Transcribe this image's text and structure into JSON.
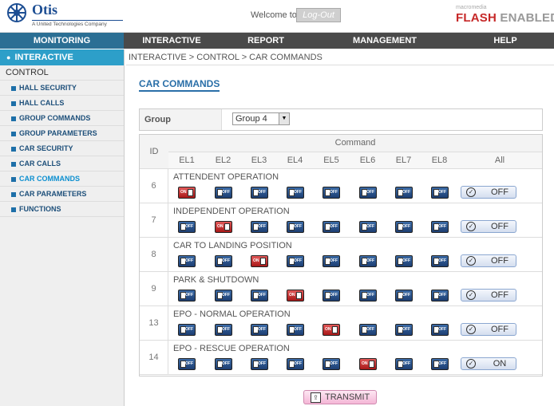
{
  "header": {
    "logo_name": "Otis",
    "logo_sub": "A United Technologies Company",
    "welcome": "Welcome to Otis",
    "logout": "Log-Out",
    "flash_brand": "macromedia",
    "flash_main": "FLASH",
    "flash_enabled": "ENABLED"
  },
  "nav": [
    "MONITORING",
    "INTERACTIVE",
    "REPORT",
    "MANAGEMENT",
    "HELP"
  ],
  "sidebar": {
    "head": "INTERACTIVE",
    "sub": "CONTROL",
    "items": [
      "HALL SECURITY",
      "HALL CALLS",
      "GROUP COMMANDS",
      "GROUP PARAMETERS",
      "CAR SECURITY",
      "CAR CALLS",
      "CAR COMMANDS",
      "CAR PARAMETERS",
      "FUNCTIONS"
    ],
    "active_index": 6
  },
  "breadcrumb": "INTERACTIVE > CONTROL > CAR COMMANDS",
  "page_title": "CAR COMMANDS",
  "group": {
    "label": "Group",
    "selected": "Group 4"
  },
  "table": {
    "id_header": "ID",
    "command_header": "Command",
    "columns": [
      "EL1",
      "EL2",
      "EL3",
      "EL4",
      "EL5",
      "EL6",
      "EL7",
      "EL8",
      "All"
    ],
    "switch_on_text": "ON",
    "switch_off_text": "OFF",
    "rows": [
      {
        "id": "6",
        "name": "ATTENDENT OPERATION",
        "states": [
          "on",
          "off",
          "off",
          "off",
          "off",
          "off",
          "off",
          "off"
        ],
        "all": "OFF"
      },
      {
        "id": "7",
        "name": "INDEPENDENT OPERATION",
        "states": [
          "off",
          "on",
          "off",
          "off",
          "off",
          "off",
          "off",
          "off"
        ],
        "all": "OFF"
      },
      {
        "id": "8",
        "name": "CAR TO LANDING POSITION",
        "states": [
          "off",
          "off",
          "on",
          "off",
          "off",
          "off",
          "off",
          "off"
        ],
        "all": "OFF"
      },
      {
        "id": "9",
        "name": "PARK & SHUTDOWN",
        "states": [
          "off",
          "off",
          "off",
          "on",
          "off",
          "off",
          "off",
          "off"
        ],
        "all": "OFF"
      },
      {
        "id": "13",
        "name": "EPO - NORMAL OPERATION",
        "states": [
          "off",
          "off",
          "off",
          "off",
          "on",
          "off",
          "off",
          "off"
        ],
        "all": "OFF"
      },
      {
        "id": "14",
        "name": "EPO - RESCUE OPERATION",
        "states": [
          "off",
          "off",
          "off",
          "off",
          "off",
          "on",
          "off",
          "off"
        ],
        "all": "ON"
      }
    ]
  },
  "transmit_label": "TRANSMIT",
  "colors": {
    "nav_bg": "#4a4a4a",
    "side_head": "#2d9fc9",
    "switch_off": "#2a5a98",
    "switch_on": "#c83232",
    "title": "#2a6fa8"
  }
}
